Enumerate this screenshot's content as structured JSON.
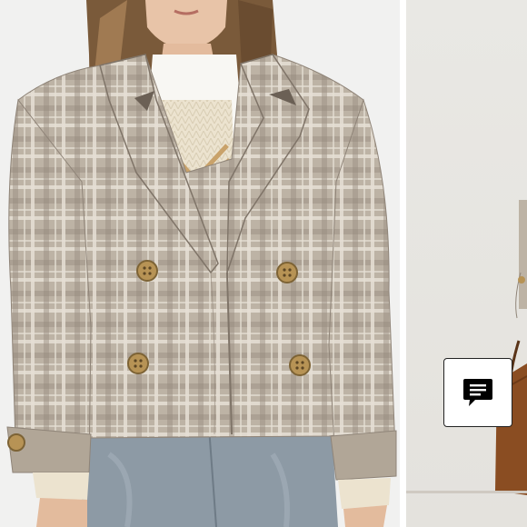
{
  "images": {
    "main": {
      "subject": "model-wearing-plaid-double-breasted-cropped-jacket",
      "colors": {
        "background": "#f1f1f0",
        "plaid_base": "#bdb3a5",
        "plaid_dark": "#8f8478",
        "plaid_light": "#e6e0d5",
        "shirt": "#f8f7f3",
        "sweater": "#ece3cf",
        "sweater_stripe": "#c9a26a",
        "denim": "#8d9aa5",
        "hair": "#7a5a3a",
        "skin": "#e8c4a8",
        "button": "#b79355"
      }
    },
    "next": {
      "subject": "next-product-image-partial",
      "colors": {
        "background": "#e7e5e0",
        "bag": "#8a4d22"
      }
    }
  },
  "chat_button": {
    "icon": "chat-bubble-icon",
    "color": "#000000"
  }
}
